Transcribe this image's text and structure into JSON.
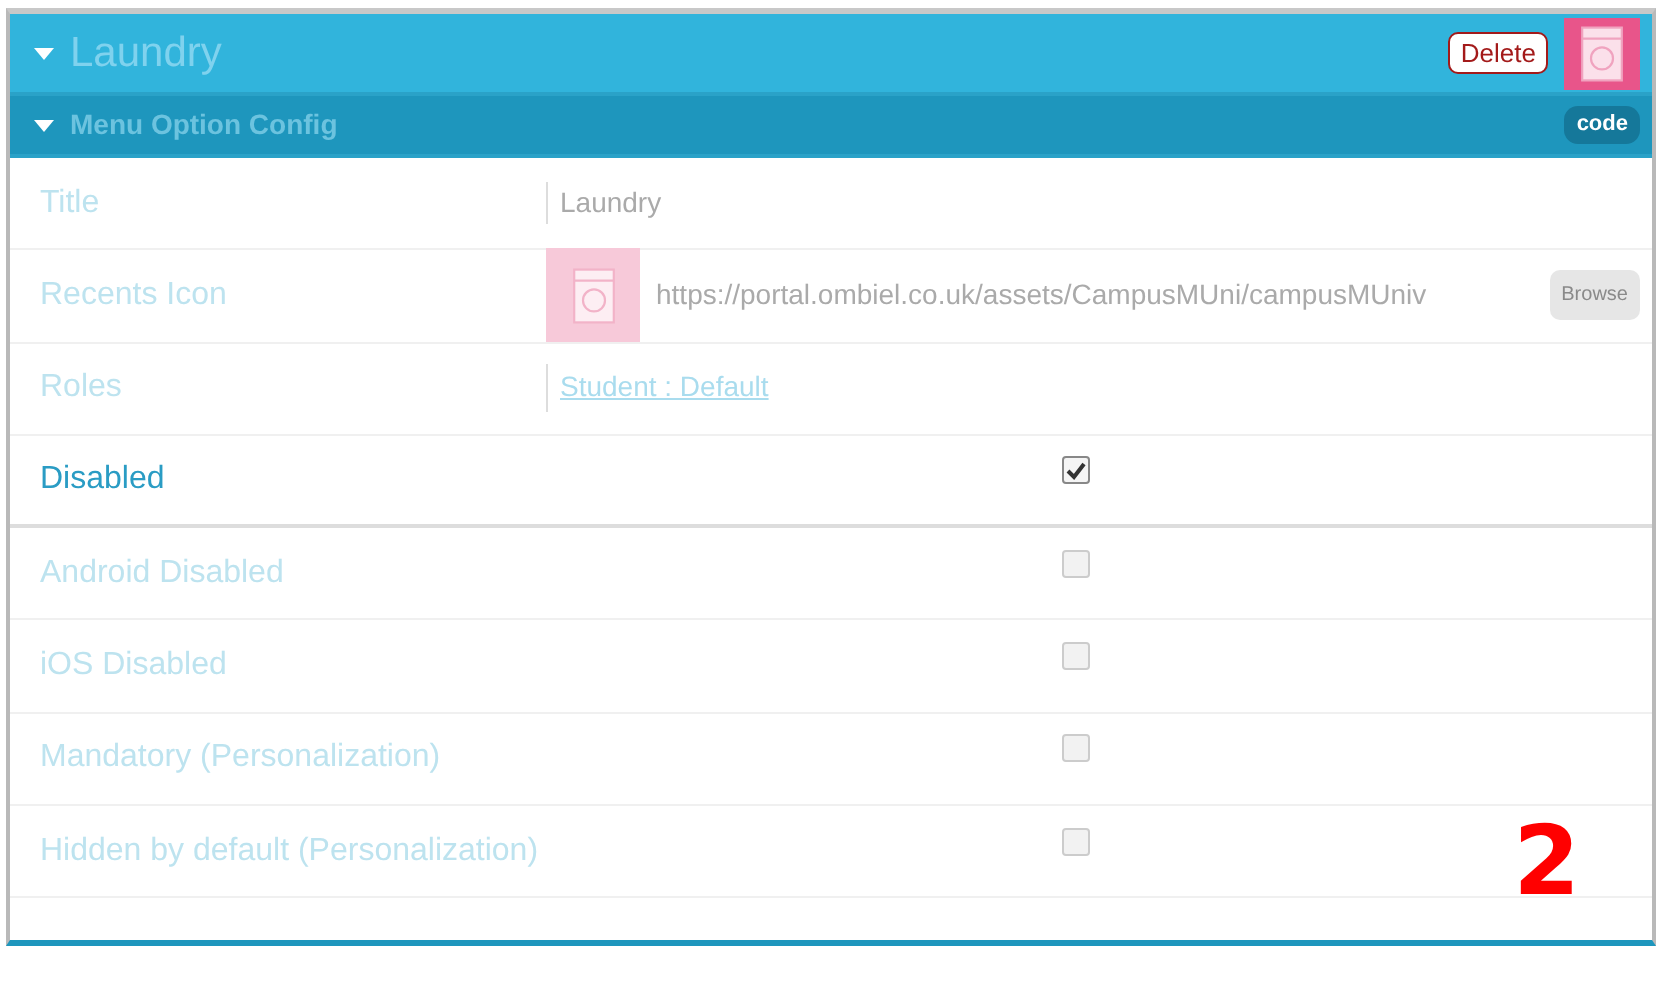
{
  "header": {
    "title": "Laundry",
    "expanded": true,
    "delete_label": "Delete"
  },
  "section": {
    "title": "Menu Option Config",
    "expanded": true,
    "code_label": "code"
  },
  "rows": [
    {
      "kind": "text",
      "label": "Title",
      "value": "Laundry",
      "emphasized": false
    },
    {
      "kind": "image",
      "label": "Recents Icon",
      "value": "https://portal.ombiel.co.uk/assets/CampusMUni/campusMUniv",
      "button": "Browse",
      "emphasized": false
    },
    {
      "kind": "link",
      "label": "Roles",
      "value": "Student : Default",
      "emphasized": false
    },
    {
      "kind": "checkbox",
      "label": "Disabled",
      "checked": true,
      "emphasized": true
    },
    {
      "kind": "checkbox",
      "label": "Android Disabled",
      "checked": false,
      "emphasized": false
    },
    {
      "kind": "checkbox",
      "label": "iOS Disabled",
      "checked": false,
      "emphasized": false
    },
    {
      "kind": "checkbox",
      "label": "Mandatory (Personalization)",
      "checked": false,
      "emphasized": false
    },
    {
      "kind": "checkbox",
      "label": "Hidden by default (Personalization)",
      "checked": false,
      "emphasized": false
    }
  ],
  "annotation": "2"
}
